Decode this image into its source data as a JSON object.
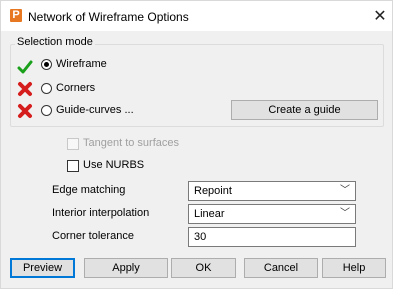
{
  "window": {
    "title": "Network of Wireframe Options",
    "app_icon_letter": "P"
  },
  "selection_mode": {
    "label": "Selection mode",
    "options": [
      {
        "label": "Wireframe",
        "selected": true,
        "status": "check-icon"
      },
      {
        "label": "Corners",
        "selected": false,
        "status": "cross-icon"
      },
      {
        "label": "Guide-curves ...",
        "selected": false,
        "status": "cross-icon"
      }
    ],
    "create_guide_label": "Create a guide"
  },
  "options": {
    "tangent_label": "Tangent to surfaces",
    "nurbs_label": "Use NURBS"
  },
  "fields": {
    "edge_matching": {
      "label": "Edge matching",
      "value": "Repoint"
    },
    "interior_interpolation": {
      "label": "Interior interpolation",
      "value": "Linear"
    },
    "corner_tolerance": {
      "label": "Corner tolerance",
      "value": "30"
    }
  },
  "buttons": {
    "preview": "Preview",
    "apply": "Apply",
    "ok": "OK",
    "cancel": "Cancel",
    "help": "Help"
  },
  "colors": {
    "check": "#1aa01a",
    "cross": "#d61d1d",
    "accent": "#0078d7",
    "app_icon": "#e87722"
  }
}
